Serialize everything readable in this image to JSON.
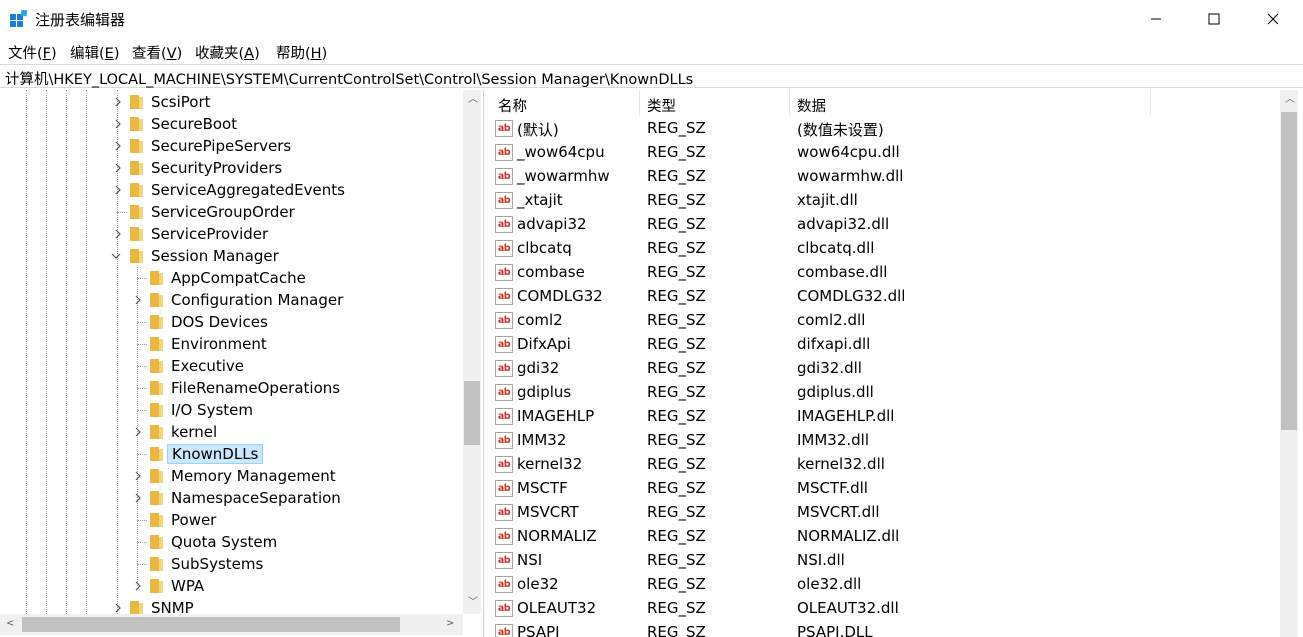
{
  "window": {
    "title": "注册表编辑器",
    "minimize_icon": "minimize-icon",
    "maximize_icon": "maximize-icon",
    "close_icon": "close-icon"
  },
  "menu": [
    {
      "label": "文件(",
      "accel": "F",
      "tail": ")"
    },
    {
      "label": "编辑(",
      "accel": "E",
      "tail": ")"
    },
    {
      "label": "查看(",
      "accel": "V",
      "tail": ")"
    },
    {
      "label": "收藏夹(",
      "accel": "A",
      "tail": ")"
    },
    {
      "label": "帮助(",
      "accel": "H",
      "tail": ")"
    }
  ],
  "address": "计算机\\HKEY_LOCAL_MACHINE\\SYSTEM\\CurrentControlSet\\Control\\Session Manager\\KnownDLLs",
  "tree": [
    {
      "label": "ScsiPort",
      "level": 0,
      "expander": "collapsed"
    },
    {
      "label": "SecureBoot",
      "level": 0,
      "expander": "collapsed"
    },
    {
      "label": "SecurePipeServers",
      "level": 0,
      "expander": "collapsed"
    },
    {
      "label": "SecurityProviders",
      "level": 0,
      "expander": "collapsed"
    },
    {
      "label": "ServiceAggregatedEvents",
      "level": 0,
      "expander": "collapsed"
    },
    {
      "label": "ServiceGroupOrder",
      "level": 0,
      "expander": "none"
    },
    {
      "label": "ServiceProvider",
      "level": 0,
      "expander": "collapsed"
    },
    {
      "label": "Session Manager",
      "level": 0,
      "expander": "expanded"
    },
    {
      "label": "AppCompatCache",
      "level": 1,
      "expander": "none"
    },
    {
      "label": "Configuration Manager",
      "level": 1,
      "expander": "collapsed"
    },
    {
      "label": "DOS Devices",
      "level": 1,
      "expander": "none"
    },
    {
      "label": "Environment",
      "level": 1,
      "expander": "none"
    },
    {
      "label": "Executive",
      "level": 1,
      "expander": "none"
    },
    {
      "label": "FileRenameOperations",
      "level": 1,
      "expander": "none"
    },
    {
      "label": "I/O System",
      "level": 1,
      "expander": "none"
    },
    {
      "label": "kernel",
      "level": 1,
      "expander": "collapsed"
    },
    {
      "label": "KnownDLLs",
      "level": 1,
      "expander": "none",
      "selected": true
    },
    {
      "label": "Memory Management",
      "level": 1,
      "expander": "collapsed"
    },
    {
      "label": "NamespaceSeparation",
      "level": 1,
      "expander": "collapsed"
    },
    {
      "label": "Power",
      "level": 1,
      "expander": "none"
    },
    {
      "label": "Quota System",
      "level": 1,
      "expander": "none"
    },
    {
      "label": "SubSystems",
      "level": 1,
      "expander": "none"
    },
    {
      "label": "WPA",
      "level": 1,
      "expander": "collapsed"
    },
    {
      "label": "SNMP",
      "level": 0,
      "expander": "collapsed"
    }
  ],
  "columns": {
    "name": "名称",
    "type": "类型",
    "data": "数据"
  },
  "values": [
    {
      "name": "(默认)",
      "type": "REG_SZ",
      "data": "(数值未设置)"
    },
    {
      "name": "_wow64cpu",
      "type": "REG_SZ",
      "data": "wow64cpu.dll"
    },
    {
      "name": "_wowarmhw",
      "type": "REG_SZ",
      "data": "wowarmhw.dll"
    },
    {
      "name": "_xtajit",
      "type": "REG_SZ",
      "data": "xtajit.dll"
    },
    {
      "name": "advapi32",
      "type": "REG_SZ",
      "data": "advapi32.dll"
    },
    {
      "name": "clbcatq",
      "type": "REG_SZ",
      "data": "clbcatq.dll"
    },
    {
      "name": "combase",
      "type": "REG_SZ",
      "data": "combase.dll"
    },
    {
      "name": "COMDLG32",
      "type": "REG_SZ",
      "data": "COMDLG32.dll"
    },
    {
      "name": "coml2",
      "type": "REG_SZ",
      "data": "coml2.dll"
    },
    {
      "name": "DifxApi",
      "type": "REG_SZ",
      "data": "difxapi.dll"
    },
    {
      "name": "gdi32",
      "type": "REG_SZ",
      "data": "gdi32.dll"
    },
    {
      "name": "gdiplus",
      "type": "REG_SZ",
      "data": "gdiplus.dll"
    },
    {
      "name": "IMAGEHLP",
      "type": "REG_SZ",
      "data": "IMAGEHLP.dll"
    },
    {
      "name": "IMM32",
      "type": "REG_SZ",
      "data": "IMM32.dll"
    },
    {
      "name": "kernel32",
      "type": "REG_SZ",
      "data": "kernel32.dll"
    },
    {
      "name": "MSCTF",
      "type": "REG_SZ",
      "data": "MSCTF.dll"
    },
    {
      "name": "MSVCRT",
      "type": "REG_SZ",
      "data": "MSVCRT.dll"
    },
    {
      "name": "NORMALIZ",
      "type": "REG_SZ",
      "data": "NORMALIZ.dll"
    },
    {
      "name": "NSI",
      "type": "REG_SZ",
      "data": "NSI.dll"
    },
    {
      "name": "ole32",
      "type": "REG_SZ",
      "data": "ole32.dll"
    },
    {
      "name": "OLEAUT32",
      "type": "REG_SZ",
      "data": "OLEAUT32.dll"
    },
    {
      "name": "PSAPI",
      "type": "REG_SZ",
      "data": "PSAPI.DLL"
    }
  ],
  "value_icon": "string-value-icon",
  "value_icon_text": "ab",
  "colors": {
    "selection": "#cce8ff",
    "folder": "#e8b842",
    "ab_text": "#c0392b"
  }
}
